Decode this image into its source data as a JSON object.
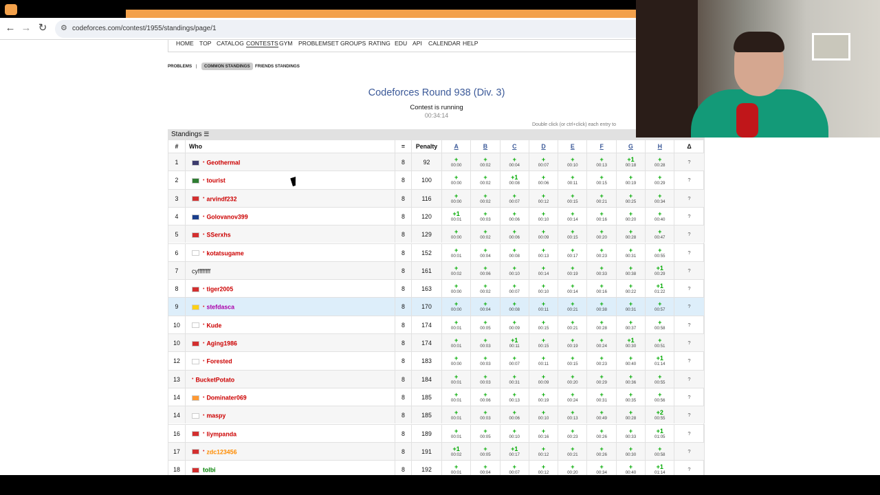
{
  "browser": {
    "url": "codeforces.com/contest/1955/standings/page/1",
    "back_icon": "arrow-left-icon",
    "forward_icon": "arrow-right-icon",
    "reload_icon": "reload-icon"
  },
  "menu": [
    "HOME",
    "TOP",
    "CATALOG",
    "CONTESTS",
    "GYM",
    "PROBLEMSET",
    "GROUPS",
    "RATING",
    "EDU",
    "API",
    "CALENDAR",
    "HELP"
  ],
  "menu_active": "CONTESTS",
  "subnav": {
    "problems": "PROBLEMS",
    "separator": "|",
    "common": "COMMON STANDINGS",
    "friends": "FRIENDS STANDINGS"
  },
  "contest": {
    "title": "Codeforces Round 938 (Div. 3)",
    "status": "Contest is running",
    "timer": "00:34:14",
    "hint": "Double click (or ctrl+click) each entry to"
  },
  "standings": {
    "caption": "Standings",
    "caption_icon": "list-icon",
    "headers": {
      "rank": "#",
      "who": "Who",
      "solved": "=",
      "penalty": "Penalty",
      "delta": "Δ"
    },
    "problems": [
      "A",
      "B",
      "C",
      "D",
      "E",
      "F",
      "G",
      "H"
    ],
    "rows": [
      {
        "rank": "1",
        "handle": "Geothermal",
        "color": "#cc0000",
        "flag": "#3c3b6e",
        "star": true,
        "solved": "8",
        "penalty": "92",
        "cells": [
          [
            "+",
            "00:00"
          ],
          [
            "+",
            "00:02"
          ],
          [
            "+",
            "00:04"
          ],
          [
            "+",
            "00:07"
          ],
          [
            "+",
            "00:10"
          ],
          [
            "+",
            "00:13"
          ],
          [
            "+1",
            "00:18"
          ],
          [
            "+",
            "00:28"
          ]
        ],
        "delta": "?"
      },
      {
        "rank": "2",
        "handle": "tourist",
        "color": "#cc0000",
        "flag": "#2e7d32",
        "star": true,
        "solved": "8",
        "penalty": "100",
        "cells": [
          [
            "+",
            "00:00"
          ],
          [
            "+",
            "00:02"
          ],
          [
            "+1",
            "00:08"
          ],
          [
            "+",
            "00:06"
          ],
          [
            "+",
            "00:11"
          ],
          [
            "+",
            "00:15"
          ],
          [
            "+",
            "00:19"
          ],
          [
            "+",
            "00:29"
          ]
        ],
        "delta": "?"
      },
      {
        "rank": "3",
        "handle": "arvindf232",
        "color": "#cc0000",
        "flag": "#d32f2f",
        "star": true,
        "solved": "8",
        "penalty": "116",
        "cells": [
          [
            "+",
            "00:00"
          ],
          [
            "+",
            "00:02"
          ],
          [
            "+",
            "00:07"
          ],
          [
            "+",
            "00:12"
          ],
          [
            "+",
            "00:15"
          ],
          [
            "+",
            "00:21"
          ],
          [
            "+",
            "00:25"
          ],
          [
            "+",
            "00:34"
          ]
        ],
        "delta": "?"
      },
      {
        "rank": "4",
        "handle": "Golovanov399",
        "color": "#cc0000",
        "flag": "#1a3e8c",
        "star": true,
        "solved": "8",
        "penalty": "120",
        "cells": [
          [
            "+1",
            "00:01"
          ],
          [
            "+",
            "00:03"
          ],
          [
            "+",
            "00:06"
          ],
          [
            "+",
            "00:10"
          ],
          [
            "+",
            "00:14"
          ],
          [
            "+",
            "00:16"
          ],
          [
            "+",
            "00:20"
          ],
          [
            "+",
            "00:40"
          ]
        ],
        "delta": "?"
      },
      {
        "rank": "5",
        "handle": "SSerxhs",
        "color": "#cc0000",
        "flag": "#d32f2f",
        "star": true,
        "solved": "8",
        "penalty": "129",
        "cells": [
          [
            "+",
            "00:00"
          ],
          [
            "+",
            "00:02"
          ],
          [
            "+",
            "00:06"
          ],
          [
            "+",
            "00:09"
          ],
          [
            "+",
            "00:15"
          ],
          [
            "+",
            "00:20"
          ],
          [
            "+",
            "00:28"
          ],
          [
            "+",
            "00:47"
          ]
        ],
        "delta": "?"
      },
      {
        "rank": "6",
        "handle": "kotatsugame",
        "color": "#cc0000",
        "flag": "#ffffff",
        "star": true,
        "solved": "8",
        "penalty": "152",
        "cells": [
          [
            "+",
            "00:01"
          ],
          [
            "+",
            "00:04"
          ],
          [
            "+",
            "00:08"
          ],
          [
            "+",
            "00:13"
          ],
          [
            "+",
            "00:17"
          ],
          [
            "+",
            "00:23"
          ],
          [
            "+",
            "00:31"
          ],
          [
            "+",
            "00:55"
          ]
        ],
        "delta": "?"
      },
      {
        "rank": "7",
        "handle": "cyffffffff",
        "color": "#222222",
        "flag": "",
        "star": false,
        "solved": "8",
        "penalty": "161",
        "cells": [
          [
            "+",
            "00:02"
          ],
          [
            "+",
            "00:06"
          ],
          [
            "+",
            "00:10"
          ],
          [
            "+",
            "00:14"
          ],
          [
            "+",
            "00:19"
          ],
          [
            "+",
            "00:33"
          ],
          [
            "+",
            "00:38"
          ],
          [
            "+1",
            "00:29"
          ]
        ],
        "delta": "?"
      },
      {
        "rank": "8",
        "handle": "tiger2005",
        "color": "#cc0000",
        "flag": "#d32f2f",
        "star": true,
        "solved": "8",
        "penalty": "163",
        "cells": [
          [
            "+",
            "00:00"
          ],
          [
            "+",
            "00:02"
          ],
          [
            "+",
            "00:07"
          ],
          [
            "+",
            "00:10"
          ],
          [
            "+",
            "00:14"
          ],
          [
            "+",
            "00:16"
          ],
          [
            "+",
            "00:22"
          ],
          [
            "+1",
            "01:22"
          ]
        ],
        "delta": "?"
      },
      {
        "rank": "9",
        "handle": "stefdasca",
        "color": "#aa00aa",
        "flag": "#fcd116",
        "star": true,
        "solved": "8",
        "penalty": "170",
        "highlight": true,
        "cells": [
          [
            "+",
            "00:00"
          ],
          [
            "+",
            "00:04"
          ],
          [
            "+",
            "00:08"
          ],
          [
            "+",
            "00:11"
          ],
          [
            "+",
            "00:21"
          ],
          [
            "+",
            "00:38"
          ],
          [
            "+",
            "00:31"
          ],
          [
            "+",
            "00:57"
          ]
        ],
        "delta": "?"
      },
      {
        "rank": "10",
        "handle": "Kude",
        "color": "#cc0000",
        "flag": "#ffffff",
        "star": true,
        "solved": "8",
        "penalty": "174",
        "cells": [
          [
            "+",
            "00:01"
          ],
          [
            "+",
            "00:05"
          ],
          [
            "+",
            "00:09"
          ],
          [
            "+",
            "00:15"
          ],
          [
            "+",
            "00:21"
          ],
          [
            "+",
            "00:28"
          ],
          [
            "+",
            "00:37"
          ],
          [
            "+",
            "00:58"
          ]
        ],
        "delta": "?"
      },
      {
        "rank": "10",
        "handle": "Aging1986",
        "color": "#cc0000",
        "flag": "#d32f2f",
        "star": true,
        "solved": "8",
        "penalty": "174",
        "cells": [
          [
            "+",
            "00:01"
          ],
          [
            "+",
            "00:03"
          ],
          [
            "+1",
            "00:11"
          ],
          [
            "+",
            "00:15"
          ],
          [
            "+",
            "00:19"
          ],
          [
            "+",
            "00:24"
          ],
          [
            "+1",
            "00:30"
          ],
          [
            "+",
            "00:51"
          ]
        ],
        "delta": "?"
      },
      {
        "rank": "12",
        "handle": "Forested",
        "color": "#cc0000",
        "flag": "#ffffff",
        "star": true,
        "solved": "8",
        "penalty": "183",
        "cells": [
          [
            "+",
            "00:00"
          ],
          [
            "+",
            "00:03"
          ],
          [
            "+",
            "00:07"
          ],
          [
            "+",
            "00:11"
          ],
          [
            "+",
            "00:15"
          ],
          [
            "+",
            "00:23"
          ],
          [
            "+",
            "00:40"
          ],
          [
            "+1",
            "01:14"
          ]
        ],
        "delta": "?"
      },
      {
        "rank": "13",
        "handle": "BucketPotato",
        "color": "#cc0000",
        "flag": "",
        "star": true,
        "solved": "8",
        "penalty": "184",
        "cells": [
          [
            "+",
            "00:01"
          ],
          [
            "+",
            "00:03"
          ],
          [
            "+",
            "00:31"
          ],
          [
            "+",
            "00:09"
          ],
          [
            "+",
            "00:20"
          ],
          [
            "+",
            "00:29"
          ],
          [
            "+",
            "00:36"
          ],
          [
            "+",
            "00:55"
          ]
        ],
        "delta": "?"
      },
      {
        "rank": "14",
        "handle": "Dominater069",
        "color": "#cc0000",
        "flag": "#ff9933",
        "star": true,
        "solved": "8",
        "penalty": "185",
        "cells": [
          [
            "+",
            "00:01"
          ],
          [
            "+",
            "00:06"
          ],
          [
            "+",
            "00:13"
          ],
          [
            "+",
            "00:19"
          ],
          [
            "+",
            "00:24"
          ],
          [
            "+",
            "00:31"
          ],
          [
            "+",
            "00:35"
          ],
          [
            "+",
            "00:56"
          ]
        ],
        "delta": "?"
      },
      {
        "rank": "14",
        "handle": "maspy",
        "color": "#cc0000",
        "flag": "#ffffff",
        "star": true,
        "solved": "8",
        "penalty": "185",
        "cells": [
          [
            "+",
            "00:01"
          ],
          [
            "+",
            "00:03"
          ],
          [
            "+",
            "00:06"
          ],
          [
            "+",
            "00:10"
          ],
          [
            "+",
            "00:13"
          ],
          [
            "+",
            "00:49"
          ],
          [
            "+",
            "00:28"
          ],
          [
            "+2",
            "00:55"
          ]
        ],
        "delta": "?"
      },
      {
        "rank": "16",
        "handle": "liympanda",
        "color": "#cc0000",
        "flag": "#d32f2f",
        "star": true,
        "solved": "8",
        "penalty": "189",
        "cells": [
          [
            "+",
            "00:01"
          ],
          [
            "+",
            "00:05"
          ],
          [
            "+",
            "00:10"
          ],
          [
            "+",
            "00:16"
          ],
          [
            "+",
            "00:23"
          ],
          [
            "+",
            "00:26"
          ],
          [
            "+",
            "00:33"
          ],
          [
            "+1",
            "01:05"
          ]
        ],
        "delta": "?"
      },
      {
        "rank": "17",
        "handle": "zdc123456",
        "color": "#ff8c00",
        "flag": "#d32f2f",
        "star": true,
        "solved": "8",
        "penalty": "191",
        "cells": [
          [
            "+1",
            "00:02"
          ],
          [
            "+",
            "00:05"
          ],
          [
            "+1",
            "00:17"
          ],
          [
            "+",
            "00:12"
          ],
          [
            "+",
            "00:21"
          ],
          [
            "+",
            "00:26"
          ],
          [
            "+",
            "00:30"
          ],
          [
            "+",
            "00:58"
          ]
        ],
        "delta": "?"
      },
      {
        "rank": "18",
        "handle": "tolbi",
        "color": "#008000",
        "flag": "#d32f2f",
        "star": false,
        "solved": "8",
        "penalty": "192",
        "cells": [
          [
            "+",
            "00:01"
          ],
          [
            "+",
            "00:04"
          ],
          [
            "+",
            "00:07"
          ],
          [
            "+",
            "00:12"
          ],
          [
            "+",
            "00:20"
          ],
          [
            "+",
            "00:34"
          ],
          [
            "+",
            "00:40"
          ],
          [
            "+1",
            "01:14"
          ]
        ],
        "delta": "?"
      }
    ]
  },
  "colors": {
    "link": "#3b5998",
    "accepted": "#00aa00",
    "highlight_row": "#ddeefa",
    "tab_orange": "#f3a14b"
  }
}
